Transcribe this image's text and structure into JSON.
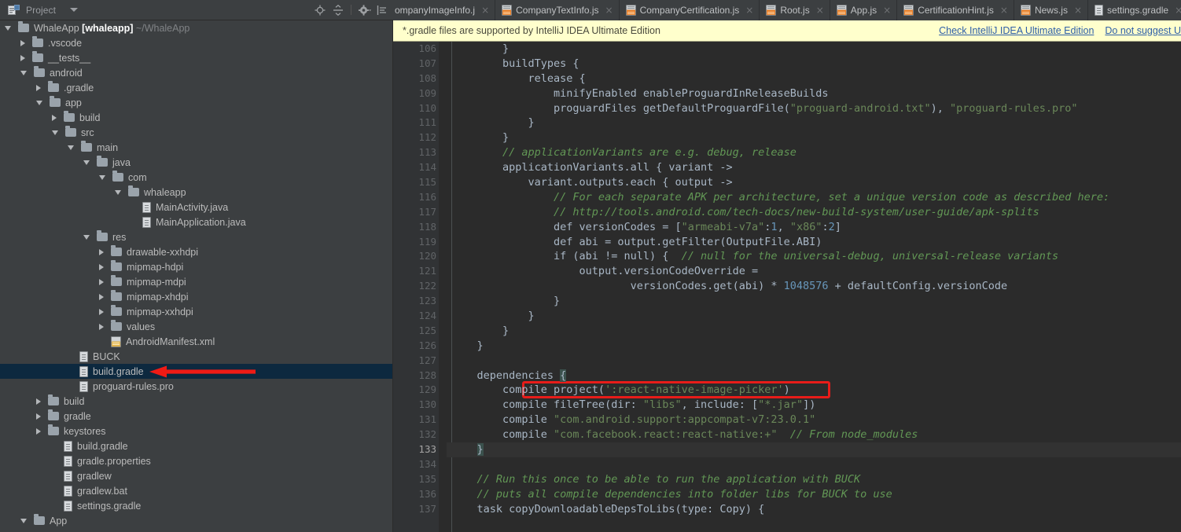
{
  "window": {
    "theme": "darcula",
    "accent_blue": "#0d293f",
    "annotation_red": "#e81c19",
    "editor_bg": "#2b2b2b",
    "panel_bg": "#3c3f41",
    "notification_bg": "#ffffcc"
  },
  "project_panel": {
    "title": "Project",
    "title_icon": "project-view-icon",
    "dropdown_icon": "chevron-down-icon",
    "toolbar": [
      {
        "name": "locate-target-icon",
        "tooltip": "Scroll from Source"
      },
      {
        "name": "collapse-all-icon",
        "tooltip": "Collapse All"
      },
      {
        "name": "gear-icon",
        "tooltip": "Settings"
      },
      {
        "name": "hide-panel-icon",
        "tooltip": "Hide"
      }
    ]
  },
  "tree": {
    "selected_label": "build.gradle",
    "annotation": "red-arrow-pointing-to-build-gradle",
    "items": [
      {
        "indent": 0,
        "state": "expanded",
        "icon": "folder-icon",
        "label": "WhaleApp",
        "bold": "[whaleapp]",
        "dim": "~/WhaleApp",
        "selected": false
      },
      {
        "indent": 1,
        "state": "collapsed",
        "icon": "folder-icon",
        "label": ".vscode",
        "selected": false
      },
      {
        "indent": 1,
        "state": "collapsed",
        "icon": "folder-icon",
        "label": "__tests__",
        "selected": false
      },
      {
        "indent": 1,
        "state": "expanded",
        "icon": "folder-icon",
        "label": "android",
        "selected": false
      },
      {
        "indent": 2,
        "state": "collapsed",
        "icon": "folder-icon",
        "label": ".gradle",
        "selected": false
      },
      {
        "indent": 2,
        "state": "expanded",
        "icon": "folder-icon",
        "label": "app",
        "selected": false
      },
      {
        "indent": 3,
        "state": "collapsed",
        "icon": "folder-icon",
        "label": "build",
        "selected": false
      },
      {
        "indent": 3,
        "state": "expanded",
        "icon": "folder-icon",
        "label": "src",
        "selected": false
      },
      {
        "indent": 4,
        "state": "expanded",
        "icon": "folder-icon",
        "label": "main",
        "selected": false
      },
      {
        "indent": 5,
        "state": "expanded",
        "icon": "folder-icon",
        "label": "java",
        "selected": false
      },
      {
        "indent": 6,
        "state": "expanded",
        "icon": "folder-icon",
        "label": "com",
        "selected": false
      },
      {
        "indent": 7,
        "state": "expanded",
        "icon": "folder-icon",
        "label": "whaleapp",
        "selected": false
      },
      {
        "indent": 8,
        "state": "leaf",
        "icon": "java-file-icon",
        "label": "MainActivity.java",
        "selected": false
      },
      {
        "indent": 8,
        "state": "leaf",
        "icon": "java-file-icon",
        "label": "MainApplication.java",
        "selected": false
      },
      {
        "indent": 5,
        "state": "expanded",
        "icon": "folder-icon",
        "label": "res",
        "selected": false
      },
      {
        "indent": 6,
        "state": "collapsed",
        "icon": "folder-icon",
        "label": "drawable-xxhdpi",
        "selected": false
      },
      {
        "indent": 6,
        "state": "collapsed",
        "icon": "folder-icon",
        "label": "mipmap-hdpi",
        "selected": false
      },
      {
        "indent": 6,
        "state": "collapsed",
        "icon": "folder-icon",
        "label": "mipmap-mdpi",
        "selected": false
      },
      {
        "indent": 6,
        "state": "collapsed",
        "icon": "folder-icon",
        "label": "mipmap-xhdpi",
        "selected": false
      },
      {
        "indent": 6,
        "state": "collapsed",
        "icon": "folder-icon",
        "label": "mipmap-xxhdpi",
        "selected": false
      },
      {
        "indent": 6,
        "state": "collapsed",
        "icon": "folder-icon",
        "label": "values",
        "selected": false
      },
      {
        "indent": 6,
        "state": "leaf",
        "icon": "xml-file-icon",
        "label": "AndroidManifest.xml",
        "selected": false
      },
      {
        "indent": 4,
        "state": "leaf",
        "icon": "file-icon",
        "label": "BUCK",
        "selected": false
      },
      {
        "indent": 4,
        "state": "leaf",
        "icon": "file-icon",
        "label": "build.gradle",
        "selected": true
      },
      {
        "indent": 4,
        "state": "leaf",
        "icon": "file-icon",
        "label": "proguard-rules.pro",
        "selected": false
      },
      {
        "indent": 2,
        "state": "collapsed",
        "icon": "folder-icon",
        "label": "build",
        "selected": false
      },
      {
        "indent": 2,
        "state": "collapsed",
        "icon": "folder-icon",
        "label": "gradle",
        "selected": false
      },
      {
        "indent": 2,
        "state": "collapsed",
        "icon": "folder-icon",
        "label": "keystores",
        "selected": false
      },
      {
        "indent": 3,
        "state": "leaf",
        "icon": "file-icon",
        "label": "build.gradle",
        "selected": false
      },
      {
        "indent": 3,
        "state": "leaf",
        "icon": "file-icon",
        "label": "gradle.properties",
        "selected": false
      },
      {
        "indent": 3,
        "state": "leaf",
        "icon": "file-icon",
        "label": "gradlew",
        "selected": false
      },
      {
        "indent": 3,
        "state": "leaf",
        "icon": "file-icon",
        "label": "gradlew.bat",
        "selected": false
      },
      {
        "indent": 3,
        "state": "leaf",
        "icon": "file-icon",
        "label": "settings.gradle",
        "selected": false
      },
      {
        "indent": 1,
        "state": "expanded",
        "icon": "folder-icon",
        "label": "App",
        "selected": false
      }
    ]
  },
  "tabs": [
    {
      "label": "ompanyImageInfo.j",
      "icon": "js-file-icon",
      "truncated": true,
      "active": false
    },
    {
      "label": "CompanyTextInfo.js",
      "icon": "js-file-icon",
      "active": false
    },
    {
      "label": "CompanyCertification.js",
      "icon": "js-file-icon",
      "active": false
    },
    {
      "label": "Root.js",
      "icon": "js-file-icon",
      "active": false
    },
    {
      "label": "App.js",
      "icon": "js-file-icon",
      "active": false
    },
    {
      "label": "CertificationHint.js",
      "icon": "js-file-icon",
      "active": false
    },
    {
      "label": "News.js",
      "icon": "js-file-icon",
      "active": false
    },
    {
      "label": "settings.gradle",
      "icon": "gradle-file-icon",
      "active": true
    }
  ],
  "tab_close_glyph": "×",
  "notification": {
    "message": "*.gradle files are supported by IntelliJ IDEA Ultimate Edition",
    "links": [
      {
        "label": "Check IntelliJ IDEA Ultimate Edition"
      },
      {
        "label": "Do not suggest U"
      }
    ]
  },
  "editor": {
    "first_line_number": 106,
    "caret_line": 133,
    "highlight_box_line": 129,
    "highlight_box_label": "red-rectangle-around-compile-project-react-native-image-picker",
    "lines": [
      {
        "n": 106,
        "tokens": [
          {
            "t": "        }",
            "c": "plain"
          }
        ]
      },
      {
        "n": 107,
        "tokens": [
          {
            "t": "        buildTypes {",
            "c": "plain"
          }
        ]
      },
      {
        "n": 108,
        "tokens": [
          {
            "t": "            release {",
            "c": "plain"
          }
        ]
      },
      {
        "n": 109,
        "tokens": [
          {
            "t": "                minifyEnabled enableProguardInReleaseBuilds",
            "c": "plain"
          }
        ]
      },
      {
        "n": 110,
        "tokens": [
          {
            "t": "                proguardFiles getDefaultProguardFile(",
            "c": "plain"
          },
          {
            "t": "\"proguard-android.txt\"",
            "c": "str"
          },
          {
            "t": "), ",
            "c": "plain"
          },
          {
            "t": "\"proguard-rules.pro\"",
            "c": "str"
          }
        ]
      },
      {
        "n": 111,
        "tokens": [
          {
            "t": "            }",
            "c": "plain"
          }
        ]
      },
      {
        "n": 112,
        "tokens": [
          {
            "t": "        }",
            "c": "plain"
          }
        ]
      },
      {
        "n": 113,
        "tokens": [
          {
            "t": "        // applicationVariants are e.g. debug, release",
            "c": "cmt"
          }
        ]
      },
      {
        "n": 114,
        "tokens": [
          {
            "t": "        applicationVariants.all { variant ->",
            "c": "plain"
          }
        ]
      },
      {
        "n": 115,
        "tokens": [
          {
            "t": "            variant.outputs.each { output ->",
            "c": "plain"
          }
        ]
      },
      {
        "n": 116,
        "tokens": [
          {
            "t": "                // For each separate APK per architecture, set a unique version code as described here:",
            "c": "cmt"
          }
        ]
      },
      {
        "n": 117,
        "tokens": [
          {
            "t": "                // http://tools.android.com/tech-docs/new-build-system/user-guide/apk-splits",
            "c": "cmt"
          }
        ]
      },
      {
        "n": 118,
        "tokens": [
          {
            "t": "                def versionCodes = [",
            "c": "plain"
          },
          {
            "t": "\"armeabi-v7a\"",
            "c": "str"
          },
          {
            "t": ":",
            "c": "plain"
          },
          {
            "t": "1",
            "c": "num"
          },
          {
            "t": ", ",
            "c": "plain"
          },
          {
            "t": "\"x86\"",
            "c": "str"
          },
          {
            "t": ":",
            "c": "plain"
          },
          {
            "t": "2",
            "c": "num"
          },
          {
            "t": "]",
            "c": "plain"
          }
        ]
      },
      {
        "n": 119,
        "tokens": [
          {
            "t": "                def abi = output.getFilter(OutputFile.ABI)",
            "c": "plain"
          }
        ]
      },
      {
        "n": 120,
        "tokens": [
          {
            "t": "                if (abi != null) {  ",
            "c": "plain"
          },
          {
            "t": "// null for the universal-debug, universal-release variants",
            "c": "cmt"
          }
        ]
      },
      {
        "n": 121,
        "tokens": [
          {
            "t": "                    output.versionCodeOverride =",
            "c": "plain"
          }
        ]
      },
      {
        "n": 122,
        "tokens": [
          {
            "t": "                            versionCodes.get(abi) * ",
            "c": "plain"
          },
          {
            "t": "1048576",
            "c": "num"
          },
          {
            "t": " + defaultConfig.versionCode",
            "c": "plain"
          }
        ]
      },
      {
        "n": 123,
        "tokens": [
          {
            "t": "                }",
            "c": "plain"
          }
        ]
      },
      {
        "n": 124,
        "tokens": [
          {
            "t": "            }",
            "c": "plain"
          }
        ]
      },
      {
        "n": 125,
        "tokens": [
          {
            "t": "        }",
            "c": "plain"
          }
        ]
      },
      {
        "n": 126,
        "tokens": [
          {
            "t": "    }",
            "c": "plain"
          }
        ]
      },
      {
        "n": 127,
        "tokens": [
          {
            "t": "",
            "c": "plain"
          }
        ]
      },
      {
        "n": 128,
        "tokens": [
          {
            "t": "    dependencies ",
            "c": "plain"
          },
          {
            "t": "{",
            "c": "brace"
          }
        ]
      },
      {
        "n": 129,
        "tokens": [
          {
            "t": "        compile project(",
            "c": "plain"
          },
          {
            "t": "':react-native-image-picker'",
            "c": "str"
          },
          {
            "t": ")",
            "c": "plain"
          }
        ]
      },
      {
        "n": 130,
        "tokens": [
          {
            "t": "        compile fileTree(dir: ",
            "c": "plain"
          },
          {
            "t": "\"libs\"",
            "c": "str"
          },
          {
            "t": ", include: [",
            "c": "plain"
          },
          {
            "t": "\"*.jar\"",
            "c": "str"
          },
          {
            "t": "])",
            "c": "plain"
          }
        ]
      },
      {
        "n": 131,
        "tokens": [
          {
            "t": "        compile ",
            "c": "plain"
          },
          {
            "t": "\"com.android.support:appcompat-v7:23.0.1\"",
            "c": "str"
          }
        ]
      },
      {
        "n": 132,
        "tokens": [
          {
            "t": "        compile ",
            "c": "plain"
          },
          {
            "t": "\"com.facebook.react:react-native:+\"",
            "c": "str"
          },
          {
            "t": "  ",
            "c": "plain"
          },
          {
            "t": "// From node_modules",
            "c": "cmt"
          }
        ]
      },
      {
        "n": 133,
        "tokens": [
          {
            "t": "    ",
            "c": "plain"
          },
          {
            "t": "}",
            "c": "brace"
          }
        ]
      },
      {
        "n": 134,
        "tokens": [
          {
            "t": "",
            "c": "plain"
          }
        ]
      },
      {
        "n": 135,
        "tokens": [
          {
            "t": "    // Run this once to be able to run the application with BUCK",
            "c": "cmt"
          }
        ]
      },
      {
        "n": 136,
        "tokens": [
          {
            "t": "    // puts all compile dependencies into folder libs for BUCK to use",
            "c": "cmt"
          }
        ]
      },
      {
        "n": 137,
        "tokens": [
          {
            "t": "    task copyDownloadableDepsToLibs(type: Copy) {",
            "c": "plain"
          }
        ]
      }
    ]
  }
}
